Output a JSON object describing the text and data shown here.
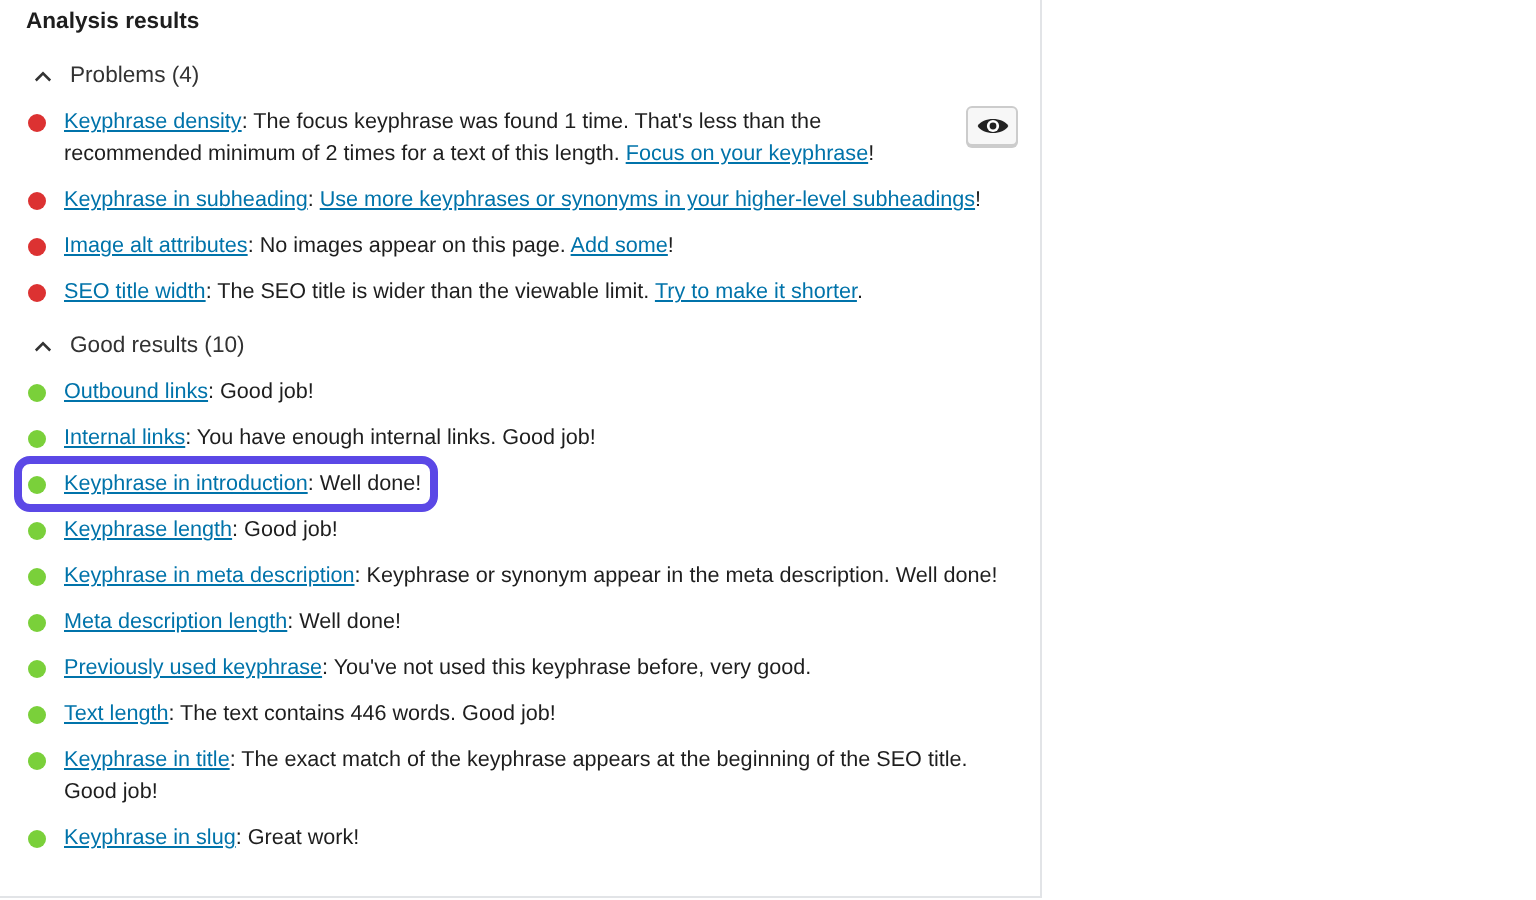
{
  "panel": {
    "title": "Analysis results"
  },
  "sections": [
    {
      "title": "Problems (4)",
      "expanded": true,
      "items": [
        {
          "color": "#dc3232",
          "highlighted": false,
          "eye_button": true,
          "parts": [
            {
              "kind": "link",
              "text": "Keyphrase density"
            },
            {
              "kind": "text",
              "text": ": The focus keyphrase was found 1 time. That's less than the recommended minimum of 2 times for a text of this length. "
            },
            {
              "kind": "link",
              "text": "Focus on your keyphrase"
            },
            {
              "kind": "text",
              "text": "!"
            }
          ]
        },
        {
          "color": "#dc3232",
          "highlighted": false,
          "eye_button": false,
          "parts": [
            {
              "kind": "link",
              "text": "Keyphrase in subheading"
            },
            {
              "kind": "text",
              "text": ": "
            },
            {
              "kind": "link",
              "text": "Use more keyphrases or synonyms in your higher-level subheadings"
            },
            {
              "kind": "text",
              "text": "!"
            }
          ]
        },
        {
          "color": "#dc3232",
          "highlighted": false,
          "eye_button": false,
          "parts": [
            {
              "kind": "link",
              "text": "Image alt attributes"
            },
            {
              "kind": "text",
              "text": ": No images appear on this page. "
            },
            {
              "kind": "link",
              "text": "Add some"
            },
            {
              "kind": "text",
              "text": "!"
            }
          ]
        },
        {
          "color": "#dc3232",
          "highlighted": false,
          "eye_button": false,
          "parts": [
            {
              "kind": "link",
              "text": "SEO title width"
            },
            {
              "kind": "text",
              "text": ": The SEO title is wider than the viewable limit. "
            },
            {
              "kind": "link",
              "text": "Try to make it shorter"
            },
            {
              "kind": "text",
              "text": "."
            }
          ]
        }
      ]
    },
    {
      "title": "Good results (10)",
      "expanded": true,
      "items": [
        {
          "color": "#7ad03a",
          "highlighted": false,
          "eye_button": false,
          "parts": [
            {
              "kind": "link",
              "text": "Outbound links"
            },
            {
              "kind": "text",
              "text": ": Good job!"
            }
          ]
        },
        {
          "color": "#7ad03a",
          "highlighted": false,
          "eye_button": false,
          "parts": [
            {
              "kind": "link",
              "text": "Internal links"
            },
            {
              "kind": "text",
              "text": ": You have enough internal links. Good job!"
            }
          ]
        },
        {
          "color": "#7ad03a",
          "highlighted": true,
          "eye_button": false,
          "parts": [
            {
              "kind": "link",
              "text": "Keyphrase in introduction"
            },
            {
              "kind": "text",
              "text": ": Well done!"
            }
          ]
        },
        {
          "color": "#7ad03a",
          "highlighted": false,
          "eye_button": false,
          "parts": [
            {
              "kind": "link",
              "text": "Keyphrase length"
            },
            {
              "kind": "text",
              "text": ": Good job!"
            }
          ]
        },
        {
          "color": "#7ad03a",
          "highlighted": false,
          "eye_button": false,
          "parts": [
            {
              "kind": "link",
              "text": "Keyphrase in meta description"
            },
            {
              "kind": "text",
              "text": ": Keyphrase or synonym appear in the meta description. Well done!"
            }
          ]
        },
        {
          "color": "#7ad03a",
          "highlighted": false,
          "eye_button": false,
          "parts": [
            {
              "kind": "link",
              "text": "Meta description length"
            },
            {
              "kind": "text",
              "text": ": Well done!"
            }
          ]
        },
        {
          "color": "#7ad03a",
          "highlighted": false,
          "eye_button": false,
          "parts": [
            {
              "kind": "link",
              "text": "Previously used keyphrase"
            },
            {
              "kind": "text",
              "text": ": You've not used this keyphrase before, very good."
            }
          ]
        },
        {
          "color": "#7ad03a",
          "highlighted": false,
          "eye_button": false,
          "parts": [
            {
              "kind": "link",
              "text": "Text length"
            },
            {
              "kind": "text",
              "text": ": The text contains 446 words. Good job!"
            }
          ]
        },
        {
          "color": "#7ad03a",
          "highlighted": false,
          "eye_button": false,
          "parts": [
            {
              "kind": "link",
              "text": "Keyphrase in title"
            },
            {
              "kind": "text",
              "text": ": The exact match of the keyphrase appears at the beginning of the SEO title. Good job!"
            }
          ]
        },
        {
          "color": "#7ad03a",
          "highlighted": false,
          "eye_button": false,
          "parts": [
            {
              "kind": "link",
              "text": "Keyphrase in slug"
            },
            {
              "kind": "text",
              "text": ": Great work!"
            }
          ]
        }
      ]
    }
  ]
}
